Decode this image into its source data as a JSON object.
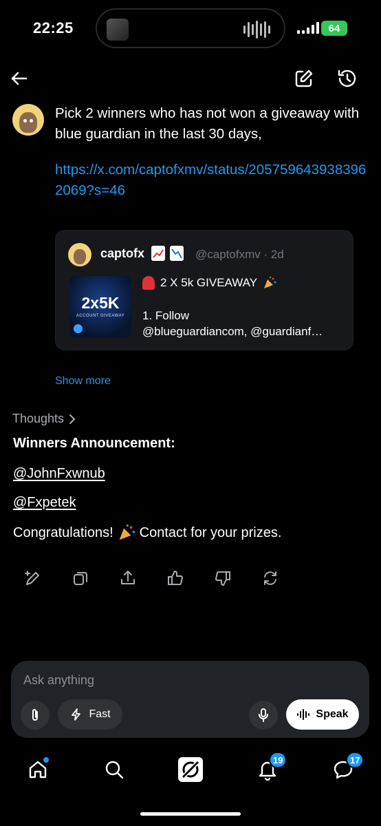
{
  "status_bar": {
    "time": "22:25",
    "battery": "64"
  },
  "header": {
    "back_icon": "arrow-left-icon",
    "edit_icon": "compose-icon",
    "history_icon": "history-icon"
  },
  "prompt": {
    "text": "Pick 2 winners who has not won a giveaway with blue guardian in the last 30 days,",
    "link": "https://x.com/captofxmv/status/2057596439383962069?s=46"
  },
  "quoted_post": {
    "name": "captofx",
    "handle_time": "@captofxmv · 2d",
    "thumb_big": "2x5K",
    "thumb_small": "ACCOUNT GIVEAWAY",
    "title": "2 X 5k GIVEAWAY",
    "body_line1": "1. Follow",
    "body_line2": "@blueguardiancom, @guardianf…"
  },
  "show_more": "Show more",
  "answer": {
    "thoughts": "Thoughts",
    "heading": "Winners Announcement:",
    "mention1": "@JohnFxwnub",
    "mention2": "@Fxpetek",
    "congrats_a": "Congratulations!",
    "congrats_b": "Contact for your prizes."
  },
  "actions": [
    "edit-prompt-icon",
    "copy-icon",
    "share-icon",
    "thumbs-up-icon",
    "thumbs-down-icon",
    "regenerate-icon"
  ],
  "composer": {
    "placeholder": "Ask anything",
    "fast_label": "Fast",
    "speak_label": "Speak"
  },
  "bottom_nav": {
    "notifications_badge": "19",
    "messages_badge": "17"
  },
  "colors": {
    "accent": "#1d9bf0",
    "card_bg": "#16181c",
    "composer_bg": "#202327",
    "battery": "#34c759"
  }
}
